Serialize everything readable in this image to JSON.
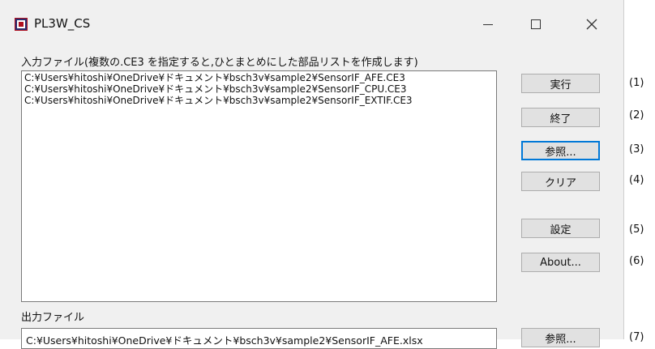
{
  "window": {
    "title": "PL3W_CS"
  },
  "input": {
    "label": "入力ファイル(複数の.CE3 を指定すると,ひとまとめにした部品リストを作成します)",
    "files": [
      "C:¥Users¥hitoshi¥OneDrive¥ドキュメント¥bsch3v¥sample2¥SensorIF_AFE.CE3",
      "C:¥Users¥hitoshi¥OneDrive¥ドキュメント¥bsch3v¥sample2¥SensorIF_CPU.CE3",
      "C:¥Users¥hitoshi¥OneDrive¥ドキュメント¥bsch3v¥sample2¥SensorIF_EXTIF.CE3"
    ]
  },
  "output": {
    "label": "出力ファイル",
    "path": "C:¥Users¥hitoshi¥OneDrive¥ドキュメント¥bsch3v¥sample2¥SensorIF_AFE.xlsx"
  },
  "buttons": {
    "run": "実行",
    "exit": "終了",
    "browse_input": "参照...",
    "clear": "クリア",
    "settings": "設定",
    "about": "About...",
    "browse_output": "参照..."
  },
  "annotations": [
    "(1)",
    "(2)",
    "(3)",
    "(4)",
    "(5)",
    "(6)",
    "(7)"
  ],
  "icons": {
    "app": "app-icon",
    "minimize": "minimize-icon",
    "maximize": "maximize-icon",
    "close": "close-icon"
  },
  "colors": {
    "window_bg": "#f0f0f0",
    "focus_border": "#0078d7",
    "button_bg": "#e1e1e1"
  }
}
